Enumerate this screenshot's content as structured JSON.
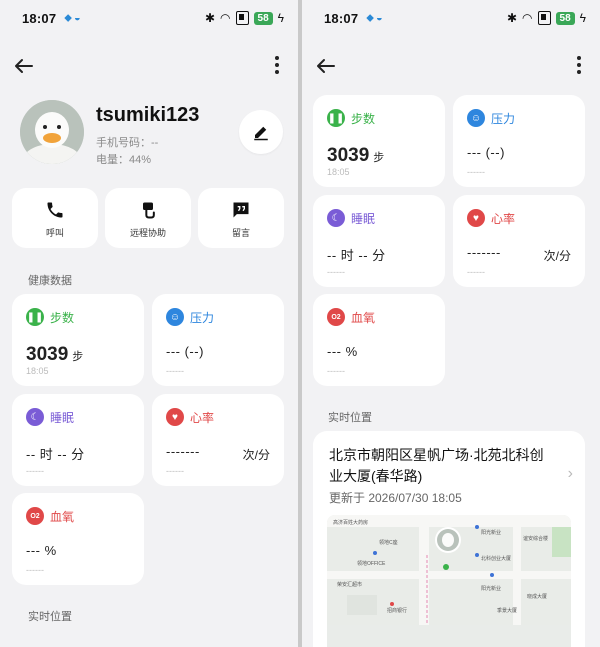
{
  "status_bar": {
    "time": "18:07",
    "battery": "58"
  },
  "profile": {
    "username": "tsumiki123",
    "phone_label": "手机号码：--",
    "battery_label": "电量：44%"
  },
  "actions": [
    {
      "label": "呼叫",
      "icon": "phone-icon"
    },
    {
      "label": "远程协助",
      "icon": "remote-assist-icon"
    },
    {
      "label": "留言",
      "icon": "message-icon"
    }
  ],
  "sections": {
    "health": "健康数据",
    "location": "实时位置"
  },
  "health": {
    "steps": {
      "title": "步数",
      "value": "3039",
      "unit": "步",
      "sub": "18:05",
      "color": "#3ab24a"
    },
    "stress": {
      "title": "压力",
      "value": "--- (--)",
      "sub": "------",
      "color": "#2e86de"
    },
    "sleep": {
      "title": "睡眠",
      "value": "-- 时 -- 分",
      "sub": "------",
      "color": "#7a5cd6"
    },
    "heart": {
      "title": "心率",
      "value": "-------",
      "unit": "次/分",
      "sub": "------",
      "color": "#e04848"
    },
    "spo2": {
      "title": "血氧",
      "value": "--- %",
      "sub": "------",
      "color": "#e04848",
      "badge": "O2"
    }
  },
  "location": {
    "address": "北京市朝阳区星帆广场·北苑北科创业大厦(春华路)",
    "updated": "更新于 2026/07/30 18:05",
    "map_pois": [
      "高济百姓大药房",
      "领地C座",
      "阳光新业",
      "领地OFFICE",
      "北科创业大厦",
      "谊安综合楼",
      "荣安汇超市",
      "阳光新业",
      "招商银行",
      "晓成大厦",
      "季景大厦"
    ]
  }
}
